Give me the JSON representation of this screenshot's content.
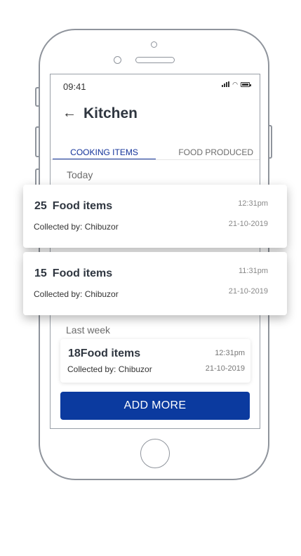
{
  "status": {
    "time": "09:41"
  },
  "header": {
    "back_icon": "←",
    "title": "Kitchen"
  },
  "tabs": [
    {
      "label": "COOKING ITEMS",
      "active": true
    },
    {
      "label": "FOOD PRODUCED",
      "active": false
    }
  ],
  "sections": {
    "today": "Today",
    "last_week": "Last week"
  },
  "today_items": [
    {
      "count": "25",
      "label": "Food items",
      "collected": "Collected by: Chibuzor",
      "time": "12:31pm",
      "date": "21-10-2019"
    },
    {
      "count": "15",
      "label": "Food items",
      "collected": "Collected by: Chibuzor",
      "time": "11:31pm",
      "date": "21-10-2019"
    }
  ],
  "last_week_items": [
    {
      "count": "18",
      "label": "Food items",
      "collected": "Collected by: Chibuzor",
      "time": "12:31pm",
      "date": "21-10-2019"
    }
  ],
  "add_button": "ADD MORE",
  "colors": {
    "primary": "#0b3a9f",
    "tab_active": "#12329a",
    "device_outline": "#8f949c"
  },
  "icons": [
    "back-arrow-icon",
    "signal-icon",
    "wifi-icon",
    "battery-icon"
  ]
}
